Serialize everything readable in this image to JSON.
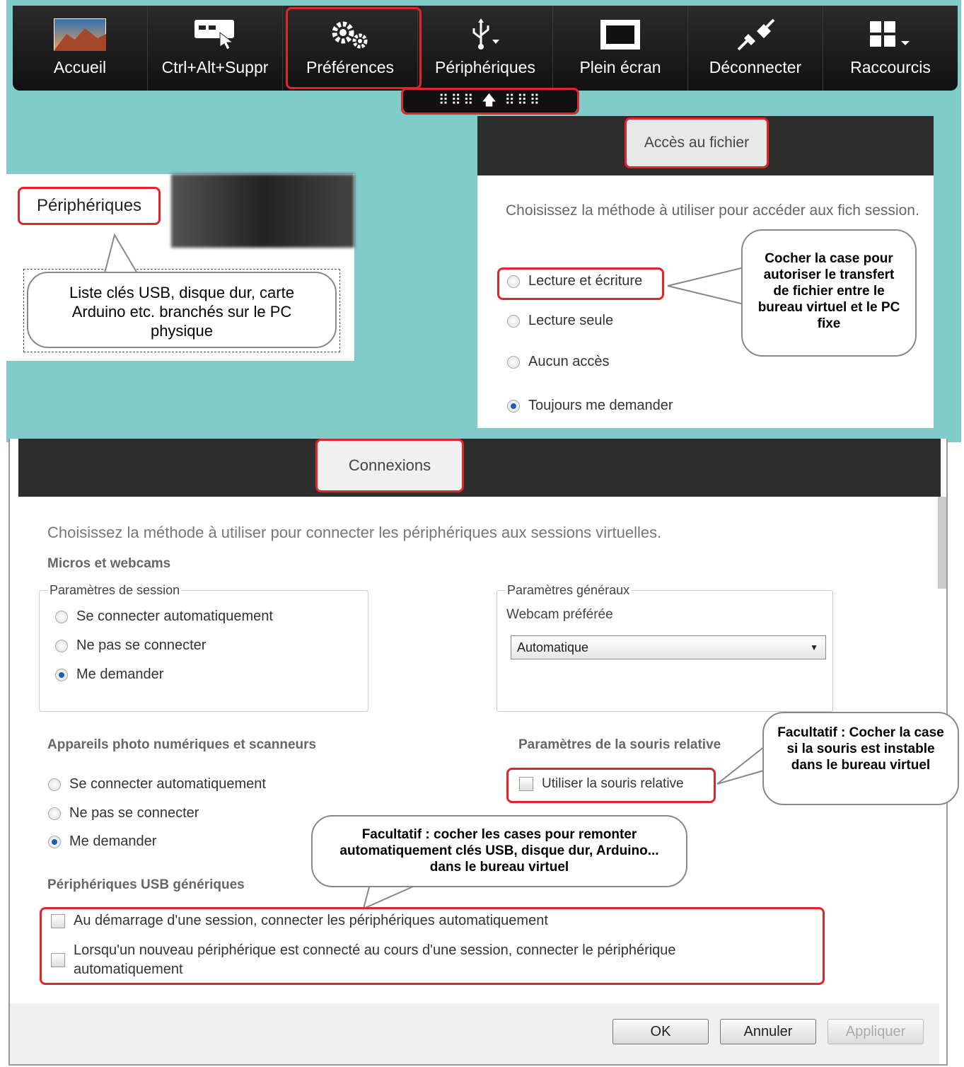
{
  "toolbar": {
    "items": [
      {
        "label": "Accueil",
        "icon": "landscape-icon"
      },
      {
        "label": "Ctrl+Alt+Suppr",
        "icon": "keyboard-hand-icon"
      },
      {
        "label": "Préférences",
        "icon": "gears-icon"
      },
      {
        "label": "Périphériques",
        "icon": "usb-icon"
      },
      {
        "label": "Plein écran",
        "icon": "fullscreen-icon"
      },
      {
        "label": "Déconnecter",
        "icon": "plug-icon"
      },
      {
        "label": "Raccourcis",
        "icon": "grid-icon"
      }
    ],
    "handle": "⠿⠿⠿ 🡅 ⠿⠿⠿"
  },
  "peripheriques": {
    "tab_label": "Périphériques",
    "callout": "Liste clés USB, disque dur, carte Arduino etc. branchés sur le PC physique"
  },
  "acces": {
    "tab_label": "Accès au fichier",
    "description": "Choisissez la méthode à utiliser pour accéder aux fich session.",
    "options": [
      "Lecture et écriture",
      "Lecture seule",
      "Aucun accès",
      "Toujours me demander"
    ],
    "selected": "Toujours me demander",
    "callout": "Cocher la case pour autoriser le transfert de fichier entre le bureau virtuel et le PC fixe"
  },
  "connexions": {
    "tab_label": "Connexions",
    "description": "Choisissez la méthode à utiliser pour connecter les périphériques aux sessions virtuelles.",
    "micros": {
      "heading": "Micros et webcams",
      "session_group": "Paramètres de session",
      "options": [
        "Se connecter automatiquement",
        "Ne pas se connecter",
        "Me demander"
      ],
      "selected": "Me demander",
      "general_group": "Paramètres généraux",
      "webcam_label": "Webcam préférée",
      "webcam_value": "Automatique"
    },
    "appareils": {
      "heading": "Appareils photo numériques et scanneurs",
      "options": [
        "Se connecter automatiquement",
        "Ne pas se connecter",
        "Me demander"
      ],
      "selected": "Me demander"
    },
    "souris": {
      "heading": "Paramètres de la souris relative",
      "checkbox": "Utiliser la souris relative",
      "callout": "Facultatif : Cocher la case si la souris est instable dans le bureau virtuel"
    },
    "usb": {
      "heading": "Périphériques USB génériques",
      "checkbox1": "Au démarrage d'une session, connecter les périphériques automatiquement",
      "checkbox2": "Lorsqu'un nouveau périphérique est connecté au cours d'une session, connecter le périphérique automatiquement",
      "callout": "Facultatif : cocher les cases pour remonter automatiquement clés USB, disque dur, Arduino... dans le bureau virtuel"
    },
    "buttons": {
      "ok": "OK",
      "cancel": "Annuler",
      "apply": "Appliquer"
    }
  },
  "colors": {
    "teal": "#7fccc8",
    "highlight": "#e0252b",
    "toolbar": "#1a1a1a"
  }
}
